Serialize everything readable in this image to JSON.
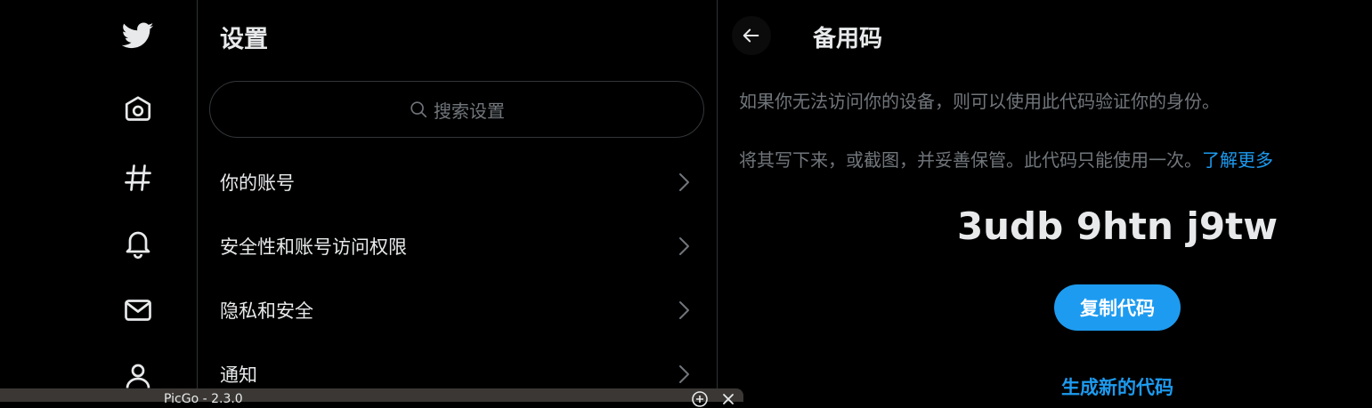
{
  "nav": {
    "icons": [
      "twitter-logo-icon",
      "home-icon",
      "hashtag-icon",
      "bell-icon",
      "mail-icon",
      "profile-icon"
    ]
  },
  "settings": {
    "title": "设置",
    "search_placeholder": "搜索设置",
    "items": [
      {
        "label": "你的账号"
      },
      {
        "label": "安全性和账号访问权限"
      },
      {
        "label": "隐私和安全"
      },
      {
        "label": "通知"
      }
    ]
  },
  "panel": {
    "title": "备用码",
    "description_1": "如果你无法访问你的设备，则可以使用此代码验证你的身份。",
    "description_2": "将其写下来，或截图，并妥善保管。此代码只能使用一次。",
    "learn_more": "了解更多",
    "code": "3udb 9htn j9tw",
    "copy_button": "复制代码",
    "generate_link": "生成新的代码"
  },
  "overlay": {
    "title": "PicGo - 2.3.0"
  },
  "colors": {
    "accent": "#1d9bf0",
    "background": "#000000",
    "text": "#e7e9ea",
    "muted": "#71767b",
    "border": "#2f3336"
  }
}
